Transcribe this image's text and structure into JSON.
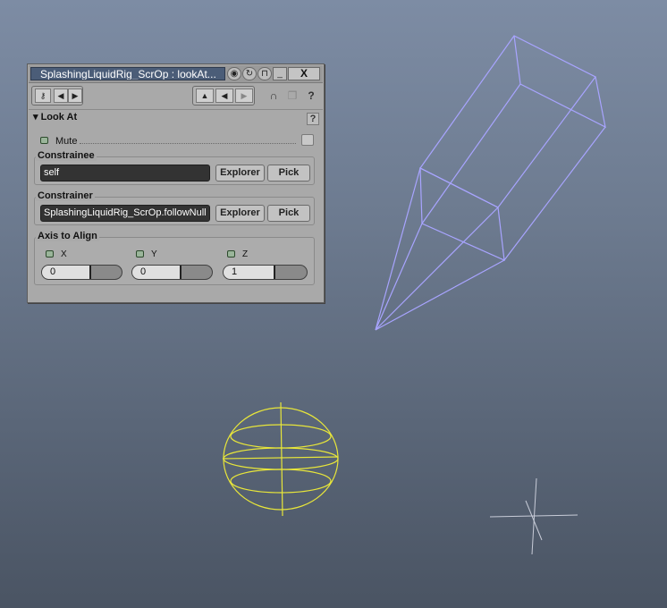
{
  "window": {
    "title": "SplashingLiquidRig_ScrOp : lookAt...",
    "close_label": "X",
    "minimize_label": "_"
  },
  "section": {
    "title": "Look At",
    "help": "?"
  },
  "mute": {
    "label": "Mute",
    "checked": false
  },
  "constrainee": {
    "label": "Constrainee",
    "value": "self",
    "explorer_label": "Explorer",
    "pick_label": "Pick"
  },
  "constrainer": {
    "label": "Constrainer",
    "value": "SplashingLiquidRig_ScrOp.followNull",
    "explorer_label": "Explorer",
    "pick_label": "Pick"
  },
  "axis": {
    "label": "Axis to Align",
    "x": {
      "label": "X",
      "value": "0",
      "level": 0.5
    },
    "y": {
      "label": "Y",
      "value": "0",
      "level": 0.5
    },
    "z": {
      "label": "Z",
      "value": "1",
      "level": 0.5
    }
  },
  "colors": {
    "viewport_top": "#7d8ca4",
    "viewport_bottom": "#4a5463",
    "wire_null": "#a8a4ff",
    "wire_sphere": "#e8e63a",
    "wire_cross": "#c8ccd8"
  }
}
